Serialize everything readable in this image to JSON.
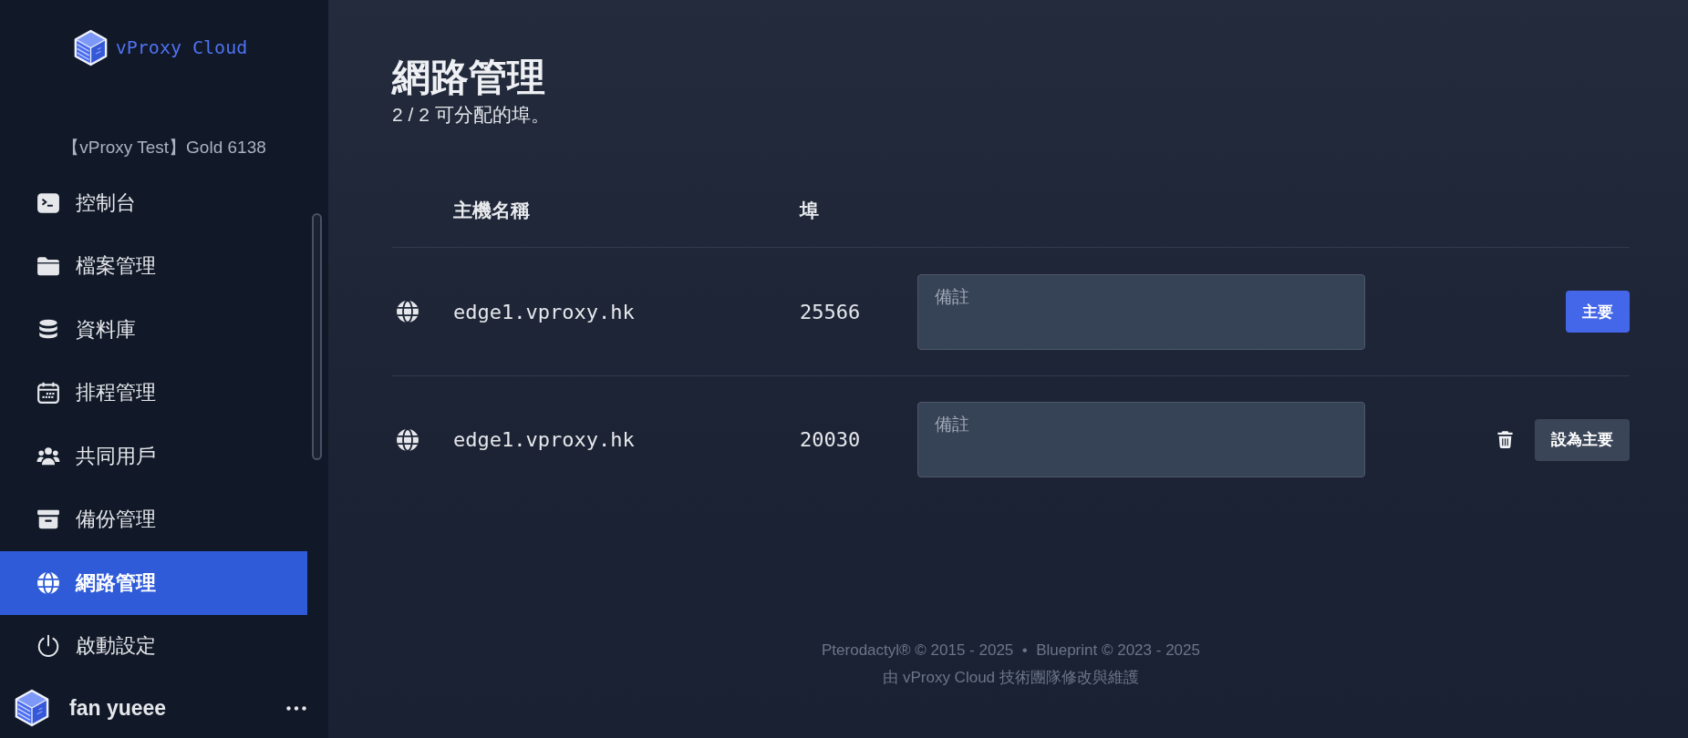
{
  "sidebar": {
    "brand": "vProxy Cloud",
    "server_name": "【vProxy Test】Gold 6138",
    "items": [
      {
        "label": "控制台",
        "selected": false
      },
      {
        "label": "檔案管理",
        "selected": false
      },
      {
        "label": "資料庫",
        "selected": false
      },
      {
        "label": "排程管理",
        "selected": false
      },
      {
        "label": "共同用戶",
        "selected": false
      },
      {
        "label": "備份管理",
        "selected": false
      },
      {
        "label": "網路管理",
        "selected": true
      },
      {
        "label": "啟動設定",
        "selected": false
      }
    ],
    "user": {
      "name": "fan yueee"
    }
  },
  "page": {
    "title": "網路管理",
    "subtitle": "2 / 2 可分配的埠。"
  },
  "table": {
    "columns": [
      "主機名稱",
      "埠"
    ],
    "rows": [
      {
        "hostname": "edge1.vproxy.hk",
        "port": "25566",
        "note": {
          "placeholder": "備註"
        },
        "primary": true,
        "action": "主要"
      },
      {
        "hostname": "edge1.vproxy.hk",
        "port": "20030",
        "note": {
          "placeholder": "備註"
        },
        "primary": false,
        "action": "設為主要"
      }
    ]
  },
  "footer": {
    "lines": [
      "Pterodactyl® © 2015 - 2025  •  Blueprint © 2023 - 2025",
      "由 vProxy Cloud 技術團隊修改與維護"
    ]
  }
}
